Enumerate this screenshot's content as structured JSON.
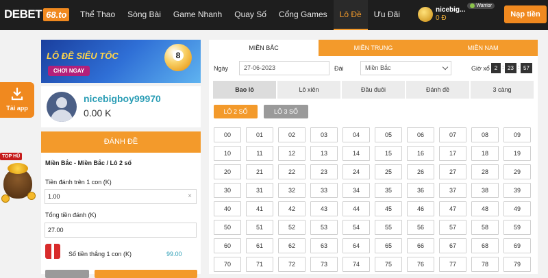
{
  "header": {
    "logo_brand": "DEBET",
    "logo_domain": "68.to",
    "nav": [
      "Thể Thao",
      "Sòng Bài",
      "Game Nhanh",
      "Quay Số",
      "Cổng Games",
      "Lô Đề",
      "Ưu Đãi"
    ],
    "active_nav": "Lô Đề",
    "username": "nicebig...",
    "balance": "0 Đ",
    "level": "Warrior",
    "deposit_label": "Nạp tiền"
  },
  "side": {
    "app_label": "Tải app",
    "tophu_label": "TOP HŨ"
  },
  "banner": {
    "title": "LÔ ĐỀ SIÊU TỐC",
    "button": "CHƠI NGAY",
    "ball_number": "8"
  },
  "profile": {
    "username": "nicebigboy99970",
    "balance": "0.00 K"
  },
  "bet": {
    "title": "ĐÁNH ĐỀ",
    "breadcrumb": "Miền Bắc - Miền Bắc / Lô 2 số",
    "stake_label": "Tiền đánh trên 1 con (K)",
    "stake_value": "1.00",
    "clear_icon": "×",
    "total_label": "Tổng tiền đánh (K)",
    "total_value": "27.00",
    "win_label": "Số tiền thắng 1 con (K)",
    "win_value": "99.00"
  },
  "regions": {
    "tabs": [
      "MIỀN BẮC",
      "MIỀN TRUNG",
      "MIỀN NAM"
    ],
    "active": 0
  },
  "filters": {
    "date_label": "Ngày",
    "date_value": "27-06-2023",
    "region_label": "Đài",
    "region_value": "Miền Bắc",
    "time_label": "Giờ xổ",
    "time": [
      "2",
      "23",
      "57"
    ]
  },
  "bet_types": [
    "Bao lô",
    "Lô xiên",
    "Đầu đuôi",
    "Đánh đề",
    "3 càng"
  ],
  "active_bet_type": 0,
  "sub_types": [
    "LÔ 2 SỐ",
    "LÔ 3 SỐ"
  ],
  "numbers": [
    "00",
    "01",
    "02",
    "03",
    "04",
    "05",
    "06",
    "07",
    "08",
    "09",
    "10",
    "11",
    "12",
    "13",
    "14",
    "15",
    "16",
    "17",
    "18",
    "19",
    "20",
    "21",
    "22",
    "23",
    "24",
    "25",
    "26",
    "27",
    "28",
    "29",
    "30",
    "31",
    "32",
    "33",
    "34",
    "35",
    "36",
    "37",
    "38",
    "39",
    "40",
    "41",
    "42",
    "43",
    "44",
    "45",
    "46",
    "47",
    "48",
    "49",
    "50",
    "51",
    "52",
    "53",
    "54",
    "55",
    "56",
    "57",
    "58",
    "59",
    "60",
    "61",
    "62",
    "63",
    "64",
    "65",
    "66",
    "67",
    "68",
    "69",
    "70",
    "71",
    "72",
    "73",
    "74",
    "75",
    "76",
    "77",
    "78",
    "79"
  ],
  "colors": {
    "accent": "#f39a2b",
    "dark": "#1e1e1e",
    "link": "#2a9db5"
  }
}
